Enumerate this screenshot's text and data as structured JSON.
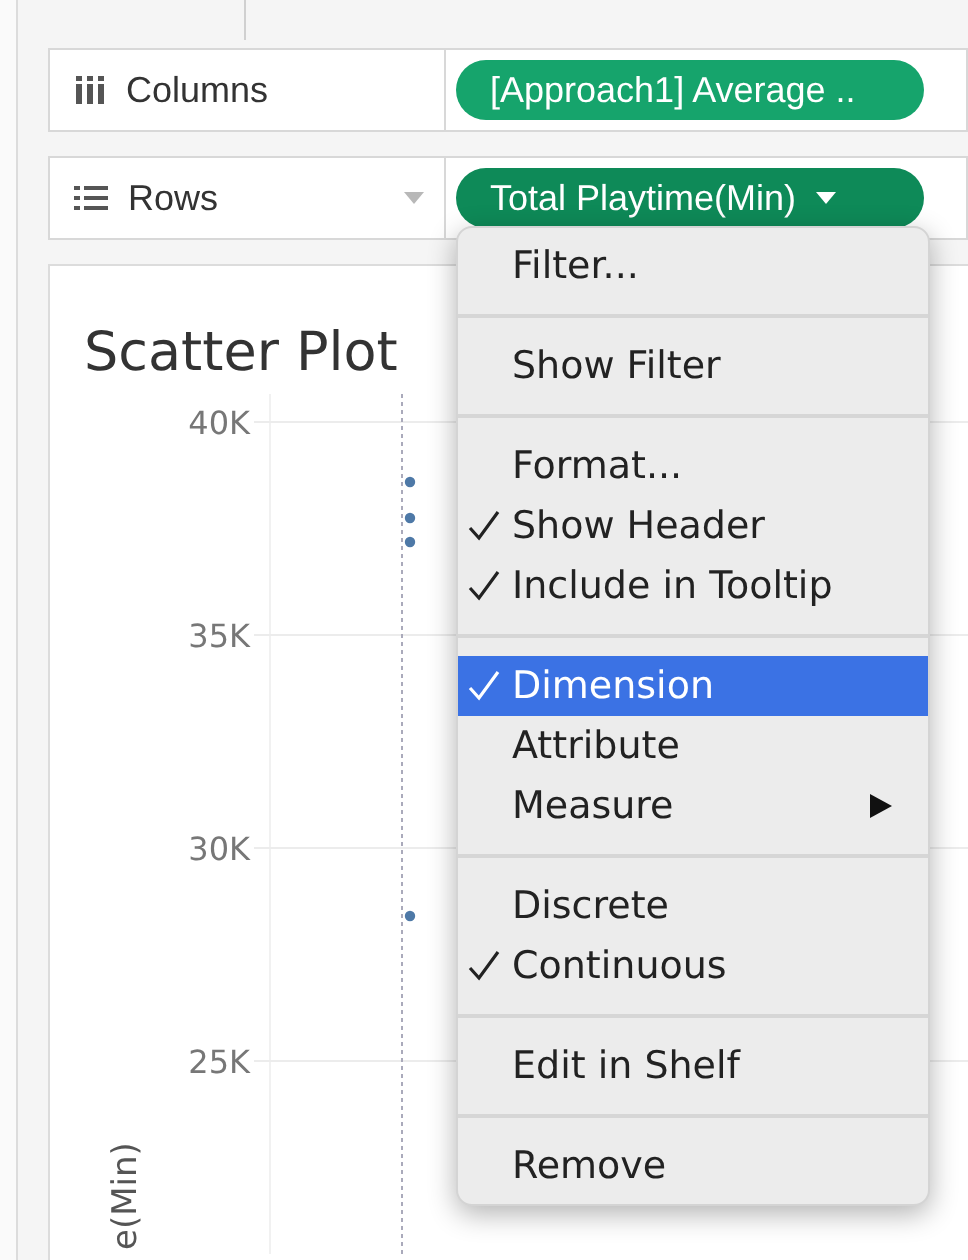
{
  "shelves": [
    {
      "kind": "columns",
      "label": "Columns",
      "pill": {
        "text": "[Approach1] Average ..",
        "selected": false
      }
    },
    {
      "kind": "rows",
      "label": "Rows",
      "pill": {
        "text": "Total Playtime(Min)",
        "selected": true
      }
    }
  ],
  "chart": {
    "title": "Scatter Plot",
    "y_axis_title": "e(Min)",
    "y_tick_labels": [
      "40K",
      "35K",
      "30K",
      "25K"
    ]
  },
  "menu": {
    "groups": [
      [
        {
          "label": "Filter...",
          "checked": false,
          "selected": false,
          "submenu": false
        }
      ],
      [
        {
          "label": "Show Filter",
          "checked": false,
          "selected": false,
          "submenu": false
        }
      ],
      [
        {
          "label": "Format...",
          "checked": false,
          "selected": false,
          "submenu": false
        },
        {
          "label": "Show Header",
          "checked": true,
          "selected": false,
          "submenu": false
        },
        {
          "label": "Include in Tooltip",
          "checked": true,
          "selected": false,
          "submenu": false
        }
      ],
      [
        {
          "label": "Dimension",
          "checked": true,
          "selected": true,
          "submenu": false
        },
        {
          "label": "Attribute",
          "checked": false,
          "selected": false,
          "submenu": false
        },
        {
          "label": "Measure",
          "checked": false,
          "selected": false,
          "submenu": true
        }
      ],
      [
        {
          "label": "Discrete",
          "checked": false,
          "selected": false,
          "submenu": false
        },
        {
          "label": "Continuous",
          "checked": true,
          "selected": false,
          "submenu": false
        }
      ],
      [
        {
          "label": "Edit in Shelf",
          "checked": false,
          "selected": false,
          "submenu": false
        }
      ],
      [
        {
          "label": "Remove",
          "checked": false,
          "selected": false,
          "submenu": false
        }
      ]
    ]
  }
}
